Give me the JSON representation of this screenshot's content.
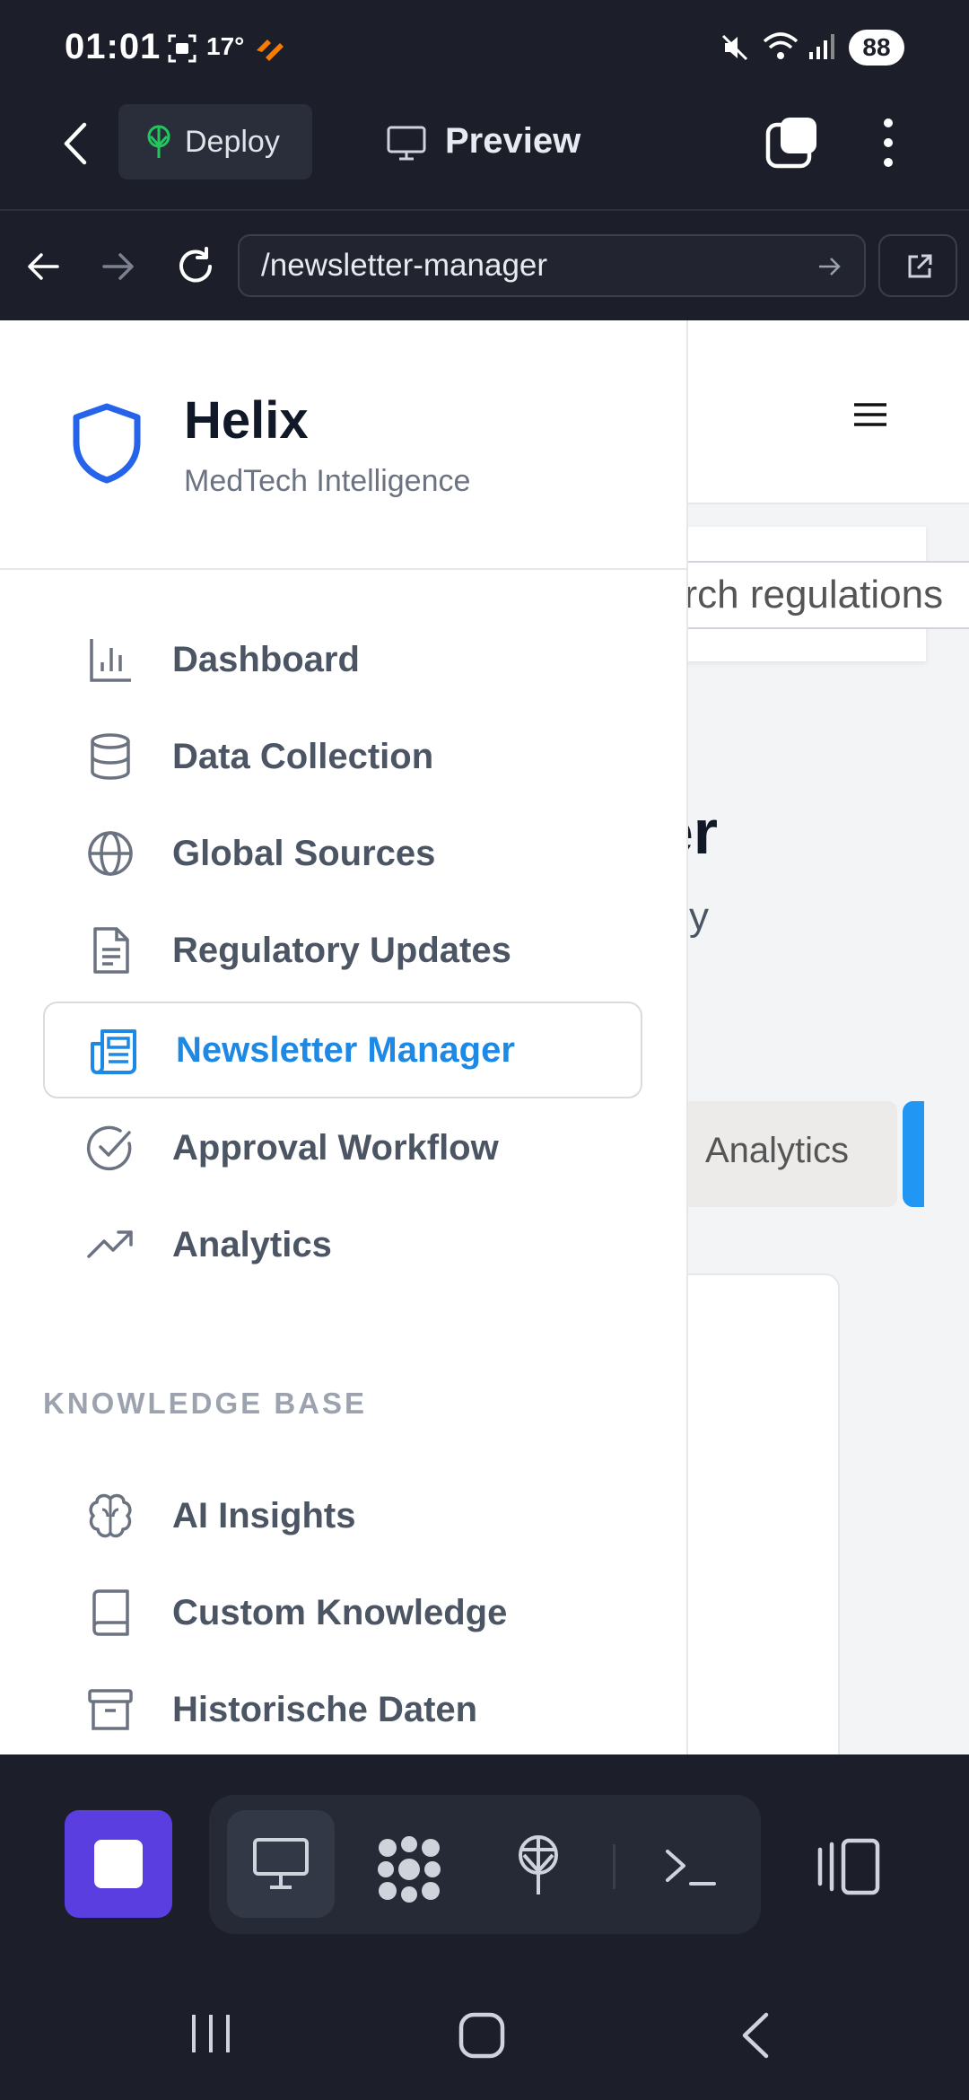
{
  "status_bar": {
    "time": "01:01",
    "temperature": "17°",
    "battery": "88"
  },
  "app_bar": {
    "deploy_label": "Deploy",
    "preview_label": "Preview"
  },
  "url_bar": {
    "path": "/newsletter-manager"
  },
  "brand": {
    "name": "Helix",
    "tagline": "MedTech Intelligence"
  },
  "nav": {
    "items": [
      {
        "label": "Dashboard",
        "icon": "bar-chart-icon"
      },
      {
        "label": "Data Collection",
        "icon": "database-icon"
      },
      {
        "label": "Global Sources",
        "icon": "globe-icon"
      },
      {
        "label": "Regulatory Updates",
        "icon": "document-icon"
      },
      {
        "label": "Newsletter Manager",
        "icon": "newspaper-icon",
        "active": true
      },
      {
        "label": "Approval Workflow",
        "icon": "check-circle-icon"
      },
      {
        "label": "Analytics",
        "icon": "trending-up-icon"
      }
    ],
    "knowledge_heading": "KNOWLEDGE BASE",
    "knowledge_items": [
      {
        "label": "AI Insights",
        "icon": "brain-icon"
      },
      {
        "label": "Custom Knowledge",
        "icon": "book-icon"
      },
      {
        "label": "Historische Daten",
        "icon": "archive-icon"
      }
    ]
  },
  "page": {
    "search_placeholder_visible": "arch regulations",
    "title_fragment": "er",
    "subtitle_fragment": "y",
    "tab_visible": "Analytics"
  },
  "colors": {
    "accent": "#1e88e5",
    "brand_shield": "#2563eb",
    "dock_stop": "#5b3ee0",
    "chrome_bg": "#1c1f2a"
  }
}
